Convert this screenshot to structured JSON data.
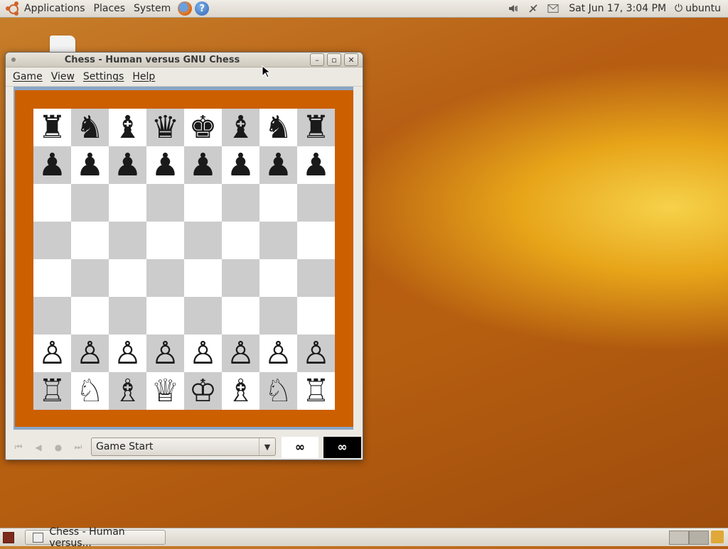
{
  "top_panel": {
    "menus": [
      "Applications",
      "Places",
      "System"
    ],
    "launchers": [
      {
        "name": "firefox-icon"
      },
      {
        "name": "help-icon",
        "glyph": "?"
      }
    ],
    "clock": "Sat Jun 17,  3:04 PM",
    "user": "ubuntu"
  },
  "window": {
    "title": "Chess - Human versus GNU Chess",
    "menu": [
      "Game",
      "View",
      "Settings",
      "Help"
    ],
    "colors": {
      "board_frame": "#cc5f00",
      "light_square": "#ffffff",
      "dark_square": "#cccccc"
    },
    "board": {
      "rows": [
        [
          "♜",
          "♞",
          "♝",
          "♛",
          "♚",
          "♝",
          "♞",
          "♜"
        ],
        [
          "♟",
          "♟",
          "♟",
          "♟",
          "♟",
          "♟",
          "♟",
          "♟"
        ],
        [
          "",
          "",
          "",
          "",
          "",
          "",
          "",
          ""
        ],
        [
          "",
          "",
          "",
          "",
          "",
          "",
          "",
          ""
        ],
        [
          "",
          "",
          "",
          "",
          "",
          "",
          "",
          ""
        ],
        [
          "",
          "",
          "",
          "",
          "",
          "",
          "",
          ""
        ],
        [
          "♙",
          "♙",
          "♙",
          "♙",
          "♙",
          "♙",
          "♙",
          "♙"
        ],
        [
          "♖",
          "♘",
          "♗",
          "♕",
          "♔",
          "♗",
          "♘",
          "♖"
        ]
      ]
    },
    "history_combo": "Game Start",
    "white_clock": "∞",
    "black_clock": "∞"
  },
  "bottom_panel": {
    "task_label": "Chess - Human versus..."
  }
}
